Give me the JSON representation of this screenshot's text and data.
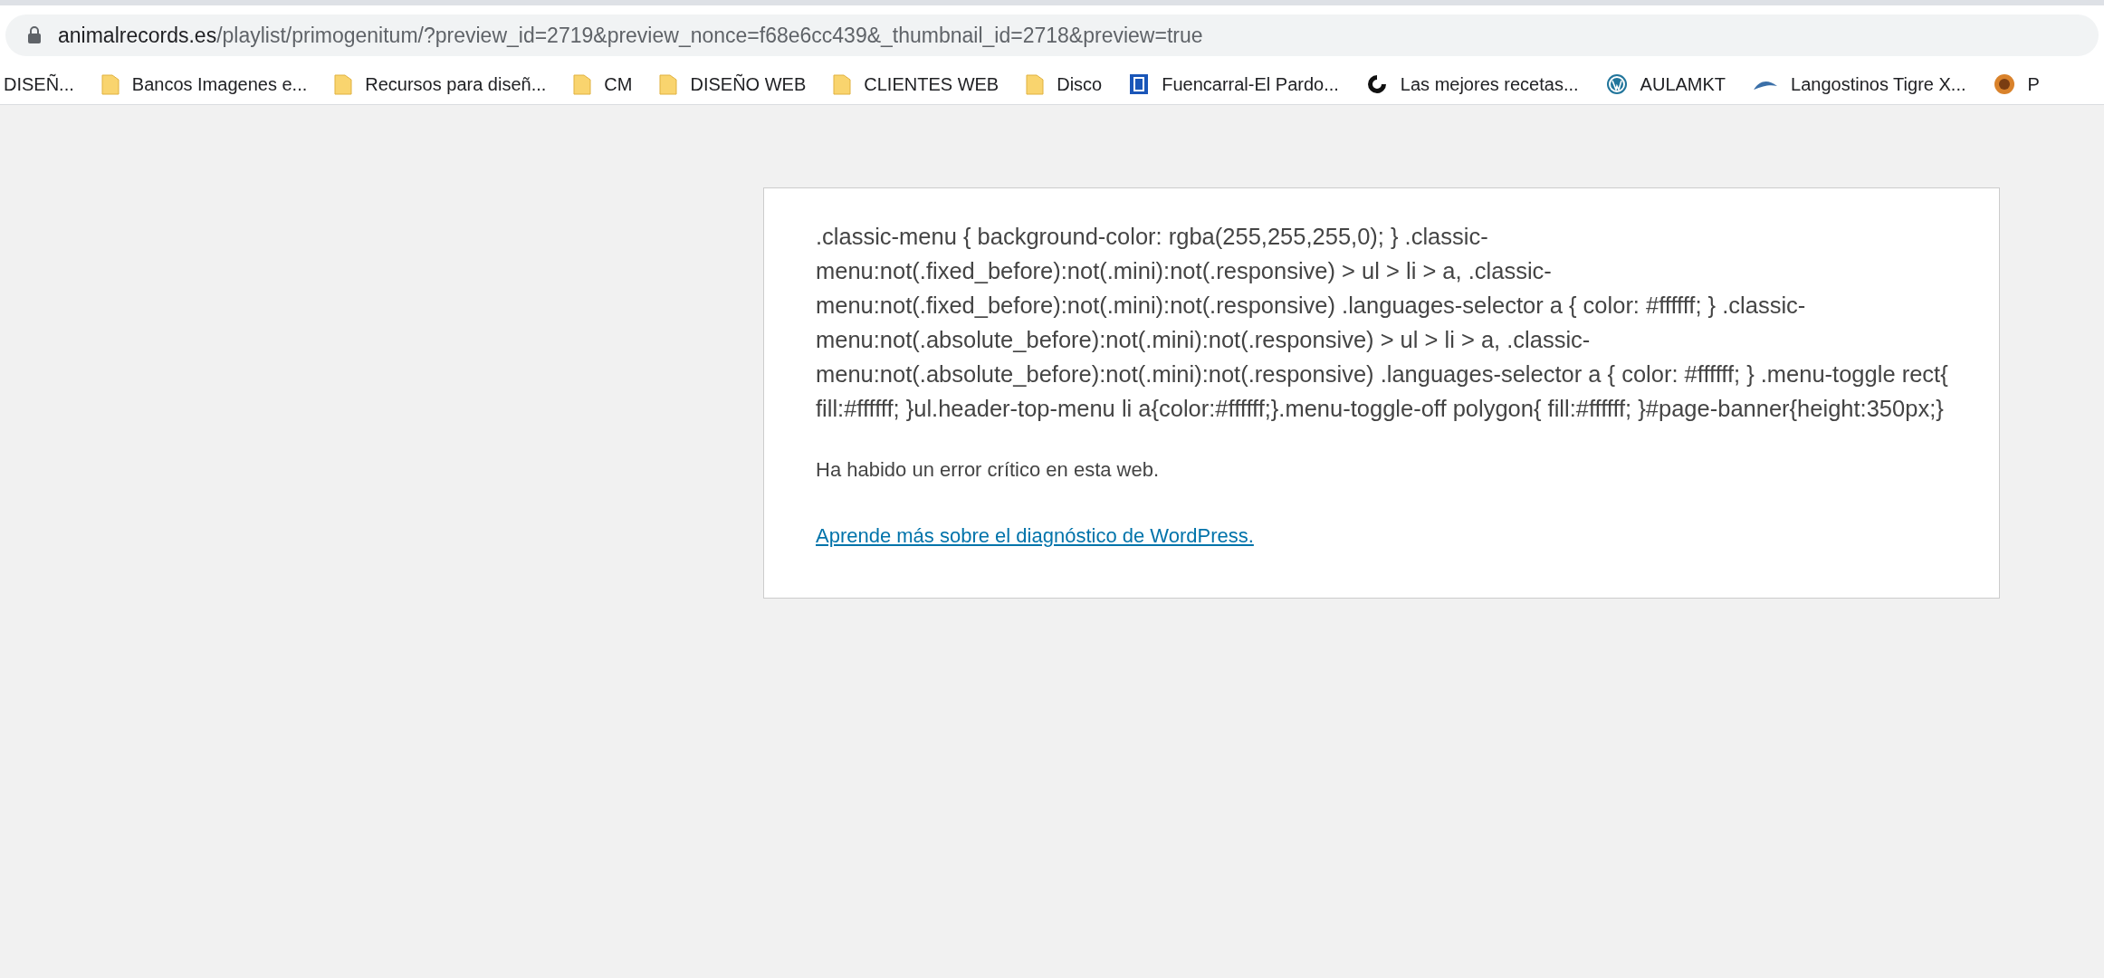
{
  "address_bar": {
    "domain": "animalrecords.es",
    "path": "/playlist/primogenitum/?preview_id=2719&preview_nonce=f68e6cc439&_thumbnail_id=2718&preview=true"
  },
  "bookmarks": [
    {
      "label": "DISEÑ...",
      "kind": "plain"
    },
    {
      "label": "Bancos Imagenes e...",
      "kind": "folder"
    },
    {
      "label": "Recursos para diseñ...",
      "kind": "folder"
    },
    {
      "label": "CM",
      "kind": "folder"
    },
    {
      "label": "DISEÑO WEB",
      "kind": "folder"
    },
    {
      "label": "CLIENTES WEB",
      "kind": "folder"
    },
    {
      "label": "Disco",
      "kind": "folder"
    },
    {
      "label": "Fuencarral-El Pardo...",
      "kind": "emblem"
    },
    {
      "label": "Las mejores recetas...",
      "kind": "swirl"
    },
    {
      "label": "AULAMKT",
      "kind": "wordpress"
    },
    {
      "label": "Langostinos Tigre X...",
      "kind": "wave"
    },
    {
      "label": "P",
      "kind": "orb"
    }
  ],
  "page": {
    "css_text": ".classic-menu { background-color: rgba(255,255,255,0); } .classic-menu:not(.fixed_before):not(.mini):not(.responsive) > ul > li > a, .classic-menu:not(.fixed_before):not(.mini):not(.responsive) .languages-selector a { color: #ffffff; } .classic-menu:not(.absolute_before):not(.mini):not(.responsive) > ul > li > a, .classic-menu:not(.absolute_before):not(.mini):not(.responsive) .languages-selector a { color: #ffffff; } .menu-toggle rect{ fill:#ffffff; }ul.header-top-menu li a{color:#ffffff;}.menu-toggle-off polygon{ fill:#ffffff; }#page-banner{height:350px;}",
    "error_message": "Ha habido un error crítico en esta web.",
    "link": "Aprende más sobre el diagnóstico de WordPress."
  }
}
